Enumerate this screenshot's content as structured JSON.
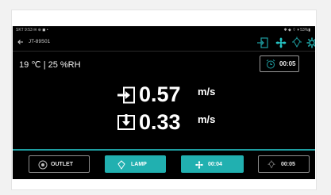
{
  "status_bar": {
    "left": "SKT 9:53 ✉ ⊕ ◼ •",
    "right": "✱ ◆ ⌔ ▾ 53%▮"
  },
  "header": {
    "device_name": "JT-89S01"
  },
  "environment": {
    "readout": "19 ℃ | 25 %RH"
  },
  "timer": {
    "value": "00:05"
  },
  "flow": {
    "outlet_value": "0.57",
    "outlet_unit": "m/s",
    "inlet_value": "0.33",
    "inlet_unit": "m/s"
  },
  "buttons": {
    "outlet_label": "OUTLET",
    "lamp_label": "LAMP",
    "fan_timer": "00:04",
    "uv_timer": "00:05"
  },
  "colors": {
    "accent": "#21b0b0",
    "background": "#000000"
  },
  "icons": [
    "back-arrow-icon",
    "door-exit-icon",
    "fan-icon",
    "uv-lamp-icon",
    "settings-gear-icon",
    "alarm-clock-icon",
    "outlet-icon",
    "lamp-icon"
  ]
}
